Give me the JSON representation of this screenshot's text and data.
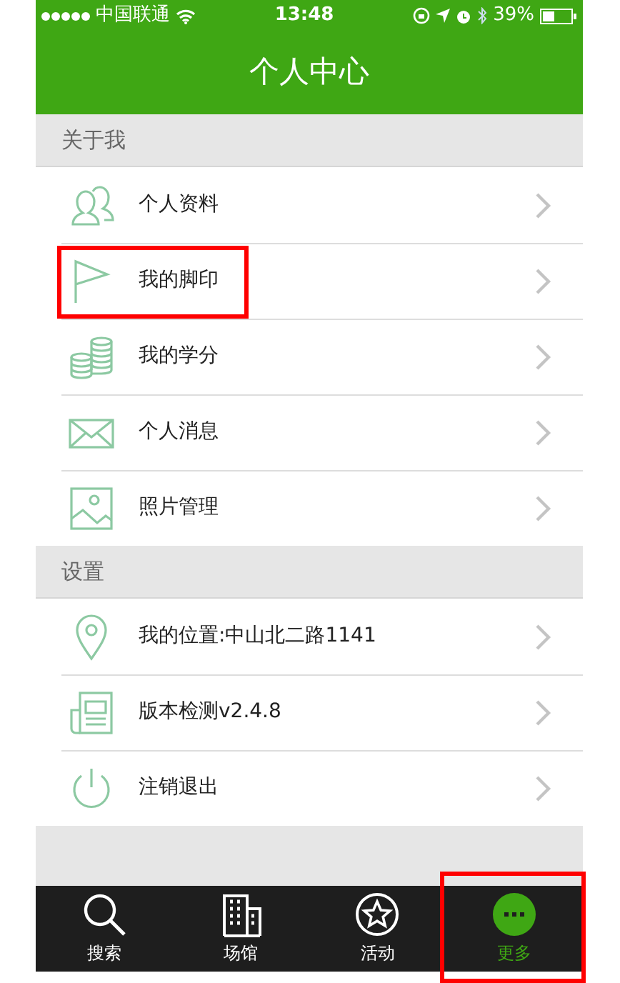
{
  "status_bar": {
    "carrier": "中国联通",
    "time": "13:48",
    "battery": "39%"
  },
  "header": {
    "title": "个人中心"
  },
  "sections": [
    {
      "title": "关于我",
      "items": [
        {
          "label": "个人资料",
          "highlighted": false
        },
        {
          "label": "我的脚印",
          "highlighted": true
        },
        {
          "label": "我的学分",
          "highlighted": false
        },
        {
          "label": "个人消息",
          "highlighted": false
        },
        {
          "label": "照片管理",
          "highlighted": false
        }
      ]
    },
    {
      "title": "设置",
      "items": [
        {
          "label": "我的位置:中山北二路1141",
          "highlighted": false
        },
        {
          "label": "版本检测v2.4.8",
          "highlighted": false
        },
        {
          "label": "注销退出",
          "highlighted": false
        }
      ]
    }
  ],
  "tabs": [
    {
      "label": "搜索",
      "selected": false,
      "highlighted": false
    },
    {
      "label": "场馆",
      "selected": false,
      "highlighted": false
    },
    {
      "label": "活动",
      "selected": false,
      "highlighted": false
    },
    {
      "label": "更多",
      "selected": true,
      "highlighted": true
    }
  ]
}
